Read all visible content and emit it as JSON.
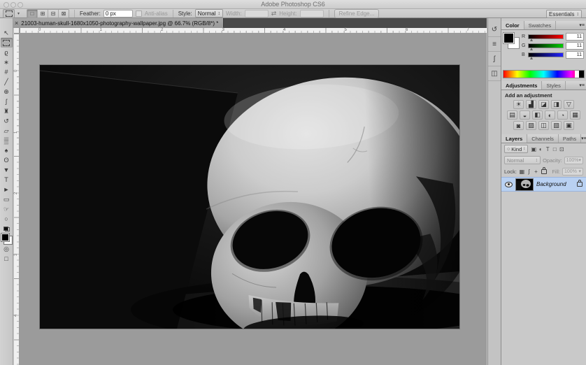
{
  "window": {
    "title": "Adobe Photoshop CS6"
  },
  "options_bar": {
    "feather_label": "Feather:",
    "feather_value": "0 px",
    "anti_alias_label": "Anti-alias",
    "style_label": "Style:",
    "style_value": "Normal",
    "width_label": "Width:",
    "width_value": "",
    "height_label": "Height:",
    "height_value": "",
    "refine_edge_label": "Refine Edge...",
    "workspace_value": "Essentials",
    "mode_buttons": [
      {
        "name": "new-selection-button",
        "glyph": "□",
        "pressed": true
      },
      {
        "name": "add-to-selection-button",
        "glyph": "⊞",
        "pressed": false
      },
      {
        "name": "subtract-from-selection-button",
        "glyph": "⊟",
        "pressed": false
      },
      {
        "name": "intersect-selection-button",
        "glyph": "⊠",
        "pressed": false
      }
    ]
  },
  "document_tab": {
    "close_glyph": "×",
    "title": "21003-human-skull-1680x1050-photography-wallpaper.jpg @ 66.7% (RGB/8*) *"
  },
  "rulers": {
    "horizontal_labels": [
      "0",
      "1",
      "2",
      "3",
      "4",
      "5",
      "6",
      "7"
    ],
    "vertical_labels": [
      "0",
      "1",
      "2",
      "3",
      "4"
    ]
  },
  "toolbar": {
    "tools": [
      {
        "name": "move-tool",
        "glyph": "↖"
      },
      {
        "name": "rectangular-marquee-tool",
        "glyph": "",
        "selected": true
      },
      {
        "name": "lasso-tool",
        "glyph": "ϱ"
      },
      {
        "name": "quick-selection-tool",
        "glyph": "∗"
      },
      {
        "name": "crop-tool",
        "glyph": "#"
      },
      {
        "name": "eyedropper-tool",
        "glyph": "╱"
      },
      {
        "name": "spot-healing-brush-tool",
        "glyph": "⊕"
      },
      {
        "name": "brush-tool",
        "glyph": "ʃ"
      },
      {
        "name": "clone-stamp-tool",
        "glyph": "♜"
      },
      {
        "name": "history-brush-tool",
        "glyph": "↺"
      },
      {
        "name": "eraser-tool",
        "glyph": "▱"
      },
      {
        "name": "gradient-tool",
        "glyph": "▒"
      },
      {
        "name": "blur-tool",
        "glyph": "♠"
      },
      {
        "name": "dodge-tool",
        "glyph": "ʘ"
      },
      {
        "name": "pen-tool",
        "glyph": "▼"
      },
      {
        "name": "type-tool",
        "glyph": "T"
      },
      {
        "name": "path-selection-tool",
        "glyph": "►"
      },
      {
        "name": "rectangle-tool",
        "glyph": "▭"
      },
      {
        "name": "hand-tool",
        "glyph": "☞"
      },
      {
        "name": "zoom-tool",
        "glyph": "○"
      },
      {
        "name": "quick-mask-button",
        "glyph": "◎"
      },
      {
        "name": "screen-mode-button",
        "glyph": "□"
      }
    ],
    "foreground_color": "#000000",
    "background_color": "#ffffff"
  },
  "dock_strip": {
    "icons": [
      {
        "name": "history-panel-icon",
        "glyph": "↺"
      },
      {
        "name": "properties-panel-icon",
        "glyph": "≡"
      },
      {
        "name": "brush-panel-icon",
        "glyph": "ʃ"
      },
      {
        "name": "clone-source-panel-icon",
        "glyph": "◫"
      }
    ]
  },
  "color_panel": {
    "tabs": [
      {
        "label": "Color",
        "active": true
      },
      {
        "label": "Swatches",
        "active": false
      }
    ],
    "channels": [
      {
        "label": "R",
        "value": "11",
        "track": "red"
      },
      {
        "label": "G",
        "value": "11",
        "track": "green"
      },
      {
        "label": "B",
        "value": "11",
        "track": "blue"
      }
    ]
  },
  "adjustments_panel": {
    "tabs": [
      {
        "label": "Adjustments",
        "active": true
      },
      {
        "label": "Styles",
        "active": false
      }
    ],
    "heading": "Add an adjustment",
    "row1": [
      {
        "name": "brightness-contrast-icon",
        "glyph": "☀"
      },
      {
        "name": "levels-icon",
        "glyph": "▟"
      },
      {
        "name": "curves-icon",
        "glyph": "◪"
      },
      {
        "name": "exposure-icon",
        "glyph": "◨"
      },
      {
        "name": "vibrance-icon",
        "glyph": "▽"
      }
    ],
    "row2": [
      {
        "name": "hue-saturation-icon",
        "glyph": "▤"
      },
      {
        "name": "color-balance-icon",
        "glyph": "◒"
      },
      {
        "name": "black-white-icon",
        "glyph": "◧"
      },
      {
        "name": "photo-filter-icon",
        "glyph": "◐"
      },
      {
        "name": "channel-mixer-icon",
        "glyph": "◔"
      },
      {
        "name": "color-lookup-icon",
        "glyph": "▦"
      }
    ],
    "row3": [
      {
        "name": "invert-icon",
        "glyph": "◙"
      },
      {
        "name": "posterize-icon",
        "glyph": "▨"
      },
      {
        "name": "threshold-icon",
        "glyph": "◫"
      },
      {
        "name": "gradient-map-icon",
        "glyph": "▧"
      },
      {
        "name": "selective-color-icon",
        "glyph": "▣"
      }
    ]
  },
  "layers_panel": {
    "tabs": [
      {
        "label": "Layers",
        "active": true
      },
      {
        "label": "Channels",
        "active": false
      },
      {
        "label": "Paths",
        "active": false
      }
    ],
    "kind_label": "Kind",
    "filter_icons": [
      {
        "name": "filter-pixel-layers-icon",
        "glyph": "▣"
      },
      {
        "name": "filter-adjustment-layers-icon",
        "glyph": "◐"
      },
      {
        "name": "filter-type-layers-icon",
        "glyph": "T"
      },
      {
        "name": "filter-shape-layers-icon",
        "glyph": "□"
      },
      {
        "name": "filter-smart-objects-icon",
        "glyph": "⊡"
      }
    ],
    "blend_mode": "Normal",
    "opacity_label": "Opacity:",
    "opacity_value": "100%",
    "lock_label": "Lock:",
    "lock_icons": [
      {
        "name": "lock-transparency-icon",
        "glyph": "▦"
      },
      {
        "name": "lock-pixels-icon",
        "glyph": "ʃ"
      },
      {
        "name": "lock-position-icon",
        "glyph": "+"
      }
    ],
    "fill_label": "Fill:",
    "fill_value": "100%",
    "layers": [
      {
        "name": "Background",
        "selected": true,
        "locked": true,
        "visible": true
      }
    ]
  },
  "glyphs": {
    "dropdown_arrow": "▾",
    "stepper": "↕",
    "swap": "⇄",
    "panel_menu": "▾≡",
    "search": "○"
  },
  "colors": {
    "selected_layer": "#b9d1f2",
    "canvas_gray": "#9b9b9b",
    "tab_strip": "#4a4a4a"
  }
}
